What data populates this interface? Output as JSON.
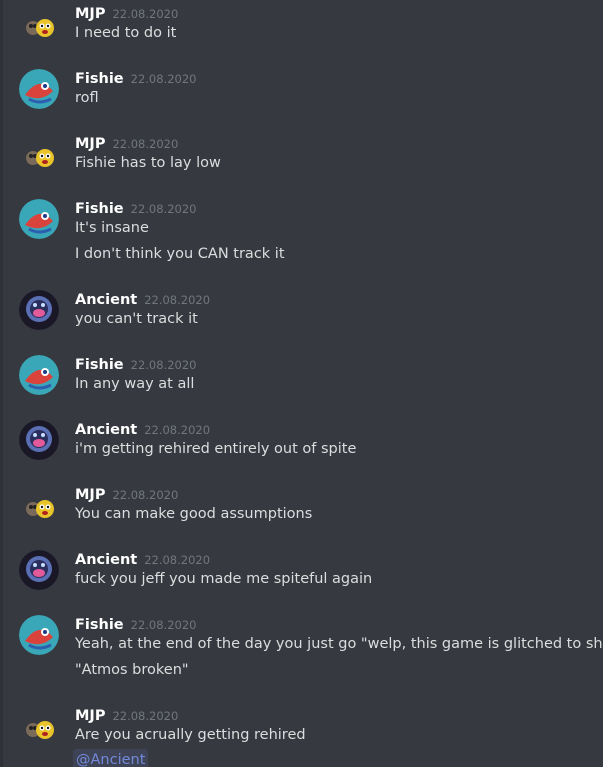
{
  "messages": [
    {
      "author": "MJP",
      "avatar": "mjp-avatar-icon",
      "time": "22.08.2020",
      "lines": [
        "I need to do it"
      ]
    },
    {
      "author": "Fishie",
      "avatar": "fishie-avatar-icon",
      "time": "22.08.2020",
      "lines": [
        "rofl"
      ]
    },
    {
      "author": "MJP",
      "avatar": "mjp-avatar-icon",
      "time": "22.08.2020",
      "lines": [
        "Fishie has to lay low"
      ]
    },
    {
      "author": "Fishie",
      "avatar": "fishie-avatar-icon",
      "time": "22.08.2020",
      "lines": [
        "It's insane",
        "I don't think you CAN track it"
      ]
    },
    {
      "author": "Ancient",
      "avatar": "ancient-avatar-icon",
      "time": "22.08.2020",
      "lines": [
        "you can't track it"
      ]
    },
    {
      "author": "Fishie",
      "avatar": "fishie-avatar-icon",
      "time": "22.08.2020",
      "lines": [
        "In any way at all"
      ]
    },
    {
      "author": "Ancient",
      "avatar": "ancient-avatar-icon",
      "time": "22.08.2020",
      "lines": [
        "i'm getting rehired entirely out of spite"
      ]
    },
    {
      "author": "MJP",
      "avatar": "mjp-avatar-icon",
      "time": "22.08.2020",
      "lines": [
        "You can make good assumptions"
      ]
    },
    {
      "author": "Ancient",
      "avatar": "ancient-avatar-icon",
      "time": "22.08.2020",
      "lines": [
        "fuck you jeff you made me spiteful again"
      ]
    },
    {
      "author": "Fishie",
      "avatar": "fishie-avatar-icon",
      "time": "22.08.2020",
      "lines": [
        "Yeah, at the end of the day you just go \"welp, this game is glitched to shit\"",
        "\"Atmos broken\""
      ]
    },
    {
      "author": "MJP",
      "avatar": "mjp-avatar-icon",
      "time": "22.08.2020",
      "lines": [
        "Are you acrually getting rehired"
      ]
    }
  ],
  "mention": "@Ancient",
  "colors": {
    "background": "#36393f",
    "username": "#ffffff",
    "timestamp": "#72767d",
    "message_text": "#dcddde",
    "mention": "#7289da"
  }
}
